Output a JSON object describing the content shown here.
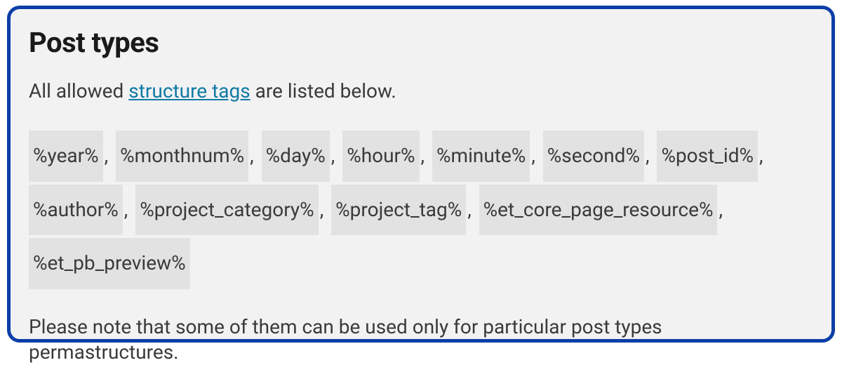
{
  "panel": {
    "heading": "Post types",
    "intro_prefix": "All allowed ",
    "intro_link": "structure tags",
    "intro_suffix": " are listed below.",
    "tags": [
      "%year%",
      "%monthnum%",
      "%day%",
      "%hour%",
      "%minute%",
      "%second%",
      "%post_id%",
      "%author%",
      "%project_category%",
      "%project_tag%",
      "%et_core_page_resource%",
      "%et_pb_preview%"
    ],
    "note": "Please note that some of them can be used only for particular post types permastructures."
  }
}
